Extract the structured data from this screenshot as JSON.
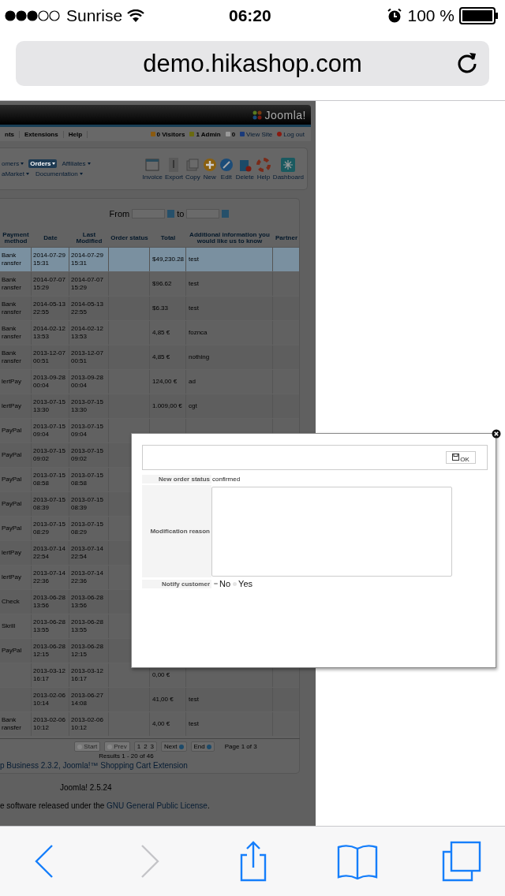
{
  "status_bar": {
    "carrier": "Sunrise",
    "time": "06:20",
    "battery": "100 %"
  },
  "url_bar": {
    "url": "demo.hikashop.com"
  },
  "page": {
    "header": {
      "logo_text": "Joomla!"
    },
    "menu": [
      {
        "label": "nts"
      },
      {
        "label": "Extensions"
      },
      {
        "label": "Help"
      }
    ],
    "admin_stats": [
      {
        "kind": "visitors",
        "label": "0 Visitors"
      },
      {
        "kind": "admin",
        "label": "1 Admin"
      },
      {
        "kind": "messages",
        "label": "0"
      },
      {
        "kind": "site",
        "label": "View Site"
      },
      {
        "kind": "logout",
        "label": "Log out"
      }
    ],
    "submenu": [
      {
        "label": "omers",
        "selected": false
      },
      {
        "label": "Orders",
        "selected": true
      },
      {
        "label": "Affiliates",
        "selected": false
      },
      {
        "label": "aMarket",
        "selected": false
      },
      {
        "label": "Documentation",
        "selected": false
      }
    ],
    "toolbar_buttons": [
      {
        "kind": "invoice",
        "label": "Invoice"
      },
      {
        "kind": "export",
        "label": "Export"
      },
      {
        "kind": "copy",
        "label": "Copy"
      },
      {
        "kind": "new",
        "label": "New"
      },
      {
        "kind": "edit",
        "label": "Edit"
      },
      {
        "kind": "delete",
        "label": "Delete"
      },
      {
        "kind": "help",
        "label": "Help"
      },
      {
        "kind": "dashboard",
        "label": "Dashboard"
      }
    ],
    "filter": {
      "from_label": "From",
      "to_label": "to"
    },
    "table": {
      "columns": [
        "Payment method",
        "Date",
        "Last Modified",
        "Order status",
        "Total",
        "Additional information you would like us to know",
        "Partner"
      ],
      "rows": [
        {
          "payment": "Bank ransfer",
          "date": "2014-07-29 15:31",
          "modified": "2014-07-29 15:31",
          "total": "$49,230.28",
          "info": "test",
          "selected": true
        },
        {
          "payment": "Bank ransfer",
          "date": "2014-07-07 15:29",
          "modified": "2014-07-07 15:29",
          "total": "$96.62",
          "info": "test",
          "selected": false
        },
        {
          "payment": "Bank ransfer",
          "date": "2014-05-13 22:55",
          "modified": "2014-05-13 22:55",
          "total": "$6.33",
          "info": "test",
          "selected": false
        },
        {
          "payment": "Bank ransfer",
          "date": "2014-02-12 13:53",
          "modified": "2014-02-12 13:53",
          "total": "4,85 €",
          "info": "foznca",
          "selected": false
        },
        {
          "payment": "Bank ransfer",
          "date": "2013-12-07 00:51",
          "modified": "2013-12-07 00:51",
          "total": "4,85 €",
          "info": "nothing",
          "selected": false
        },
        {
          "payment": "lertPay",
          "date": "2013-09-28 00:04",
          "modified": "2013-09-28 00:04",
          "total": "124,00 €",
          "info": "ad",
          "selected": false
        },
        {
          "payment": "lertPay",
          "date": "2013-07-15 13:30",
          "modified": "2013-07-15 13:30",
          "total": "1.009,00 €",
          "info": "cgt",
          "selected": false
        },
        {
          "payment": "PayPal",
          "date": "2013-07-15 09:04",
          "modified": "2013-07-15 09:04",
          "selected": false
        },
        {
          "payment": "PayPal",
          "date": "2013-07-15 09:02",
          "modified": "2013-07-15 09:02",
          "selected": false
        },
        {
          "payment": "PayPal",
          "date": "2013-07-15 08:58",
          "modified": "2013-07-15 08:58",
          "selected": false
        },
        {
          "payment": "PayPal",
          "date": "2013-07-15 08:39",
          "modified": "2013-07-15 08:39",
          "selected": false
        },
        {
          "payment": "PayPal",
          "date": "2013-07-15 08:29",
          "modified": "2013-07-15 08:29",
          "selected": false
        },
        {
          "payment": "lertPay",
          "date": "2013-07-14 22:54",
          "modified": "2013-07-14 22:54",
          "selected": false
        },
        {
          "payment": "lertPay",
          "date": "2013-07-14 22:36",
          "modified": "2013-07-14 22:36",
          "selected": false
        },
        {
          "payment": "Check",
          "date": "2013-06-28 13:56",
          "modified": "2013-06-28 13:56",
          "selected": false
        },
        {
          "payment": "Skrill",
          "date": "2013-06-28 13:55",
          "modified": "2013-06-28 13:55",
          "selected": false
        },
        {
          "payment": "PayPal",
          "date": "2013-06-28 12:15",
          "modified": "2013-06-28 12:15",
          "selected": false
        },
        {
          "date": "2013-03-12 16:17",
          "modified": "2013-03-12 16:17",
          "total": "0,00 €",
          "selected": false
        },
        {
          "date": "2013-02-06 10:14",
          "modified": "2013-06-27 14:08",
          "total": "41,00 €",
          "info": "test",
          "selected": false
        },
        {
          "payment": "Bank ransfer",
          "date": "2013-02-06 10:12",
          "modified": "2013-02-06 10:12",
          "total": "4,00 €",
          "info": "test",
          "selected": false
        }
      ]
    },
    "pagination": {
      "buttons": [
        {
          "label": "Start",
          "disabled": true
        },
        {
          "label": "Prev",
          "disabled": true
        }
      ],
      "pages": [
        "1",
        "2",
        "3"
      ],
      "next_buttons": [
        {
          "label": "Next"
        },
        {
          "label": "End"
        }
      ],
      "page_info": "Page 1 of 3",
      "results": "Results 1 - 20 of 46"
    },
    "credit_link": "p Business 2.3.2, Joomla!™ Shopping Cart Extension",
    "version": "Joomla! 2.5.24",
    "license_text": "e software released under the ",
    "license_link": "GNU General Public License",
    "license_end": "."
  },
  "modal": {
    "ok_button": "OK",
    "fields": [
      {
        "label": "New order status",
        "value": "confirmed"
      },
      {
        "label": "Modification reason"
      }
    ],
    "notify": {
      "label": "Notify customer",
      "options": [
        {
          "label": "No",
          "selected": true
        },
        {
          "label": "Yes",
          "selected": false
        }
      ]
    }
  },
  "browser_toolbar": [
    {
      "kind": "back",
      "disabled": false
    },
    {
      "kind": "forward",
      "disabled": true
    },
    {
      "kind": "share",
      "disabled": false
    },
    {
      "kind": "bookmarks",
      "disabled": false
    },
    {
      "kind": "tabs",
      "disabled": false
    }
  ]
}
